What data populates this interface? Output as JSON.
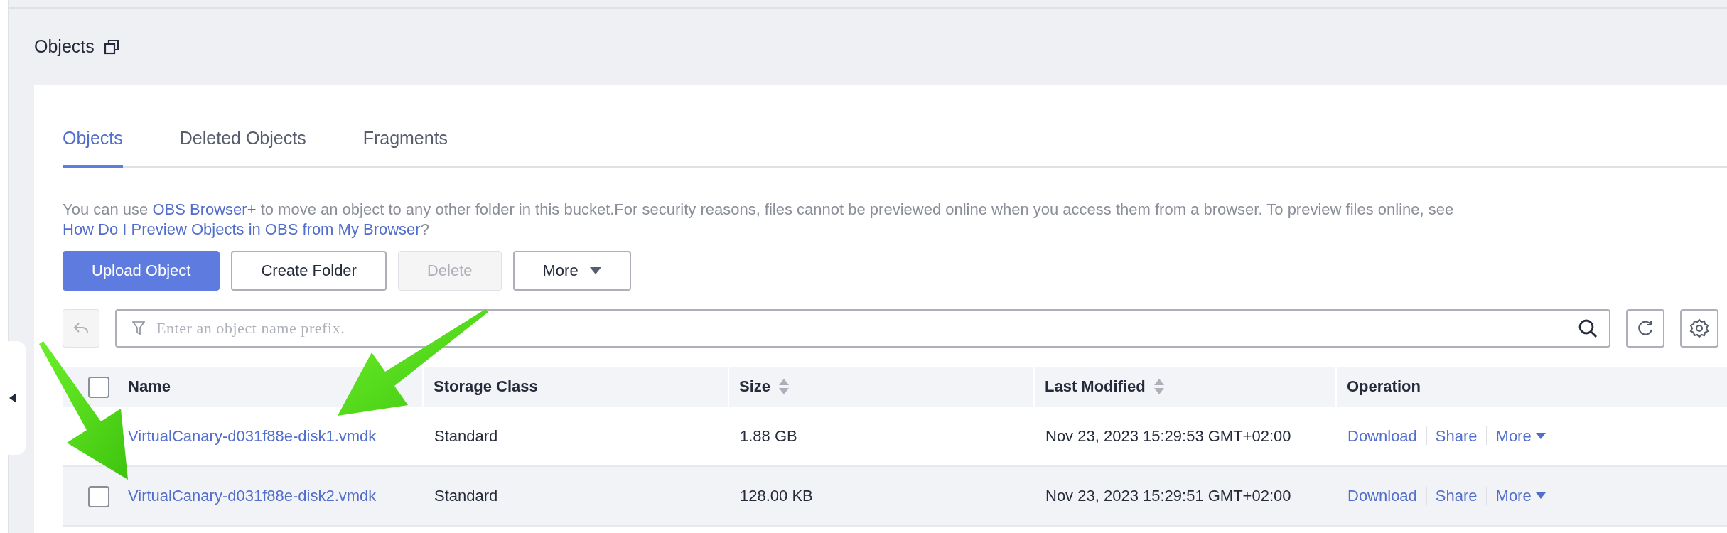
{
  "page_title": "Objects",
  "tabs": [
    {
      "label": "Objects",
      "selected": true
    },
    {
      "label": "Deleted Objects",
      "selected": false
    },
    {
      "label": "Fragments",
      "selected": false
    }
  ],
  "notice": [
    {
      "kind": "text",
      "text": "You can use "
    },
    {
      "kind": "link",
      "text": "OBS Browser+"
    },
    {
      "kind": "text",
      "text": " to move an object to any other folder in this bucket.For security reasons, files cannot be previewed online when you access them from a browser. To preview files online, see "
    },
    {
      "kind": "link",
      "text": "How Do I Preview Objects in OBS from My Browser"
    },
    {
      "kind": "text",
      "text": "?"
    }
  ],
  "buttons": [
    {
      "label": "Upload Object",
      "kind": "primary",
      "disabled": false
    },
    {
      "label": "Create Folder",
      "kind": "default",
      "disabled": false
    },
    {
      "label": "Delete",
      "kind": "default",
      "disabled": true
    },
    {
      "label": "More",
      "kind": "dropdown",
      "disabled": false
    }
  ],
  "search": {
    "placeholder": "Enter an object name prefix."
  },
  "table": {
    "select_all": {
      "checked": false
    },
    "columns": [
      {
        "label": "Name",
        "sortable": false
      },
      {
        "label": "Storage Class",
        "sortable": false
      },
      {
        "label": "Size",
        "sortable": true
      },
      {
        "label": "Last Modified",
        "sortable": true
      },
      {
        "label": "Operation",
        "sortable": false
      }
    ],
    "rows": [
      {
        "highlighted": false,
        "name": "VirtualCanary-d031f88e-disk1.vmdk",
        "storage_class": "Standard",
        "size": "1.88 GB",
        "last_modified": "Nov 23, 2023 15:29:53 GMT+02:00",
        "operations": [
          "Download",
          "Share",
          "More"
        ]
      },
      {
        "checked": false,
        "highlighted": true,
        "name": "VirtualCanary-d031f88e-disk2.vmdk",
        "storage_class": "Standard",
        "size": "128.00 KB",
        "last_modified": "Nov 23, 2023 15:29:51 GMT+02:00",
        "operations": [
          "Download",
          "Share",
          "More"
        ]
      }
    ]
  }
}
